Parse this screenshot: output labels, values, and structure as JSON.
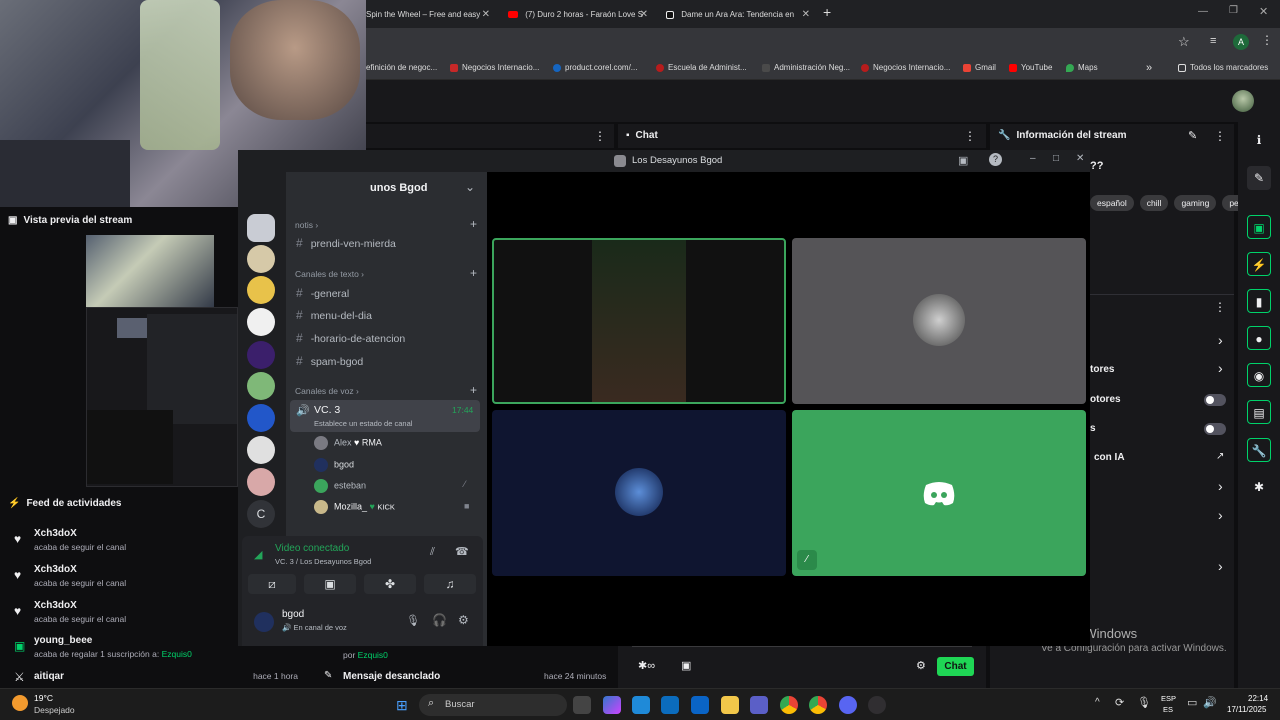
{
  "browser": {
    "tabs": [
      {
        "title": "Spin the Wheel – Free and easy"
      },
      {
        "title": "(7) Duro 2 horas - Faraón Love S"
      },
      {
        "title": "Dame un Ara Ara: Tendencia en"
      }
    ],
    "bookmarks": [
      {
        "label": "efinición de negoc..."
      },
      {
        "label": "Negocios Internacio..."
      },
      {
        "label": "product.corel.com/..."
      },
      {
        "label": "Escuela de Administ..."
      },
      {
        "label": "Administración Neg..."
      },
      {
        "label": "Negocios Internacio..."
      },
      {
        "label": "Gmail"
      },
      {
        "label": "YouTube"
      },
      {
        "label": "Maps"
      }
    ],
    "all_bookmarks": "Todos los marcadores",
    "profile_letter": "A"
  },
  "twitch": {
    "preview_title": "Vista previa del stream",
    "activity_title": "Feed de actividades",
    "chat_title": "Chat",
    "stream_info_title": "Información del stream",
    "stream_title_fragment": "??",
    "tags": [
      "español",
      "chill",
      "gaming",
      "perú"
    ],
    "activity": [
      {
        "user": "Xch3doX",
        "text": "acaba de seguir el canal"
      },
      {
        "user": "Xch3doX",
        "text": "acaba de seguir el canal"
      },
      {
        "user": "Xch3doX",
        "text": "acaba de seguir el canal"
      },
      {
        "user": "young_beee",
        "text": "acaba de regalar 1 suscripción a:",
        "target": "Ezquis0"
      },
      {
        "user": "aitiqar",
        "time": "hace 1 hora"
      }
    ],
    "pinned": {
      "by": "por",
      "user": "Ezquis0",
      "title": "Mensaje desanclado",
      "time": "hace 24 minutos"
    },
    "chat_button": "Chat",
    "right_items": [
      {
        "label": "tores"
      },
      {
        "label": "otores"
      },
      {
        "label": "s"
      },
      {
        "label": "con IA"
      }
    ],
    "watermark_title": "Activar Windows",
    "watermark_sub": "Ve a Configuración para activar Windows."
  },
  "discord": {
    "window_title": "Los Desayunos Bgod",
    "server_name": "unos Bgod",
    "server_letter": "C",
    "channels": {
      "cat_notis": "notis",
      "notis_channel": "prendi-ven-mierda",
      "cat_text": "Canales de texto",
      "text": [
        "-general",
        "menu-del-dia",
        "-horario-de-atencion",
        "spam-bgod"
      ],
      "cat_voice": "Canales de voz",
      "voice_channel": "VC. 3",
      "voice_time": "17:44",
      "voice_status": "Establece un estado de canal",
      "members": [
        {
          "name": "Alex",
          "badge": "RMA"
        },
        {
          "name": "bgod",
          "badge": ""
        },
        {
          "name": "esteban",
          "badge": ""
        },
        {
          "name": "Mozilla_",
          "badge": "KICK"
        }
      ]
    },
    "voice_panel": {
      "status": "Video conectado",
      "location": "VC. 3 / Los Desayunos Bgod"
    },
    "user": {
      "name": "bgod",
      "status": "En canal de voz"
    }
  },
  "taskbar": {
    "weather_temp": "19°C",
    "weather_desc": "Despejado",
    "search_placeholder": "Buscar",
    "lang_top": "ESP",
    "lang_bottom": "ES",
    "time": "22:14",
    "date": "17/11/2025"
  }
}
